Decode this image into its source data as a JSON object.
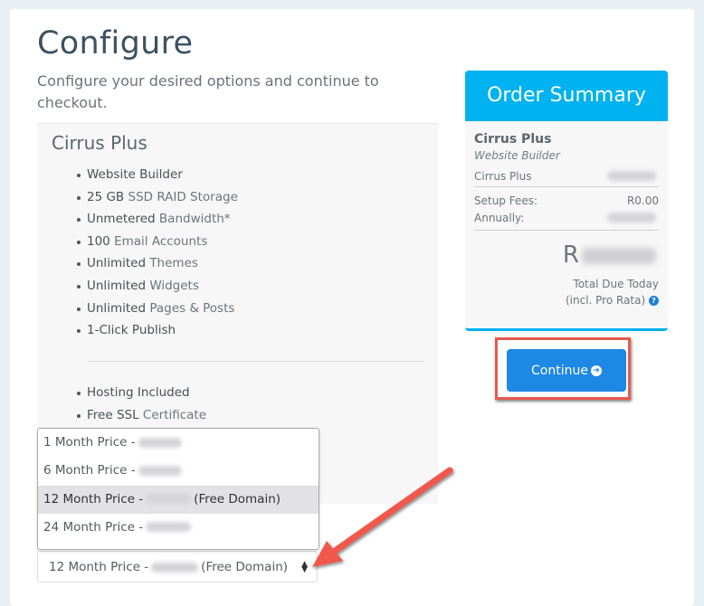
{
  "header": {
    "title": "Configure",
    "subtitle": "Configure your desired options and continue to checkout."
  },
  "product": {
    "name": "Cirrus Plus",
    "features": [
      {
        "strong": "Website Builder",
        "rest": ""
      },
      {
        "strong": "25 GB",
        "rest": "SSD RAID Storage"
      },
      {
        "strong": "Unmetered",
        "rest": "Bandwidth*"
      },
      {
        "strong": "100",
        "rest": "Email Accounts"
      },
      {
        "strong": "Unlimited",
        "rest": "Themes"
      },
      {
        "strong": "Unlimited",
        "rest": "Widgets"
      },
      {
        "strong": "Unlimited",
        "rest": "Pages & Posts"
      },
      {
        "strong": "1-Click Publish",
        "rest": ""
      }
    ],
    "extras": [
      {
        "strong": "Hosting Included",
        "rest": ""
      },
      {
        "strong": "Free SSL",
        "rest": "Certificate"
      }
    ]
  },
  "billing_cycle": {
    "options": [
      {
        "label": "1 Month Price -",
        "suffix": ""
      },
      {
        "label": "6 Month Price -",
        "suffix": ""
      },
      {
        "label": "12 Month Price -",
        "suffix": "(Free Domain)"
      },
      {
        "label": "24 Month Price -",
        "suffix": ""
      }
    ],
    "selected_index": 2,
    "selected_label": "12 Month Price -",
    "selected_suffix": "(Free Domain)"
  },
  "order_summary": {
    "title": "Order Summary",
    "product_name": "Cirrus Plus",
    "product_group": "Website Builder",
    "line_item_label": "Cirrus Plus",
    "setup_fees_label": "Setup Fees:",
    "setup_fees_value": "R0.00",
    "annually_label": "Annually:",
    "total_currency": "R",
    "total_due_label": "Total Due Today",
    "pro_rata_label": "(incl. Pro Rata)",
    "help_icon": "question-circle-icon"
  },
  "actions": {
    "continue_label": "Continue",
    "continue_icon": "arrow-circle-right-icon"
  },
  "colors": {
    "accent": "#00b2f0",
    "button": "#1e88e5",
    "annotation": "#e85a4f"
  }
}
